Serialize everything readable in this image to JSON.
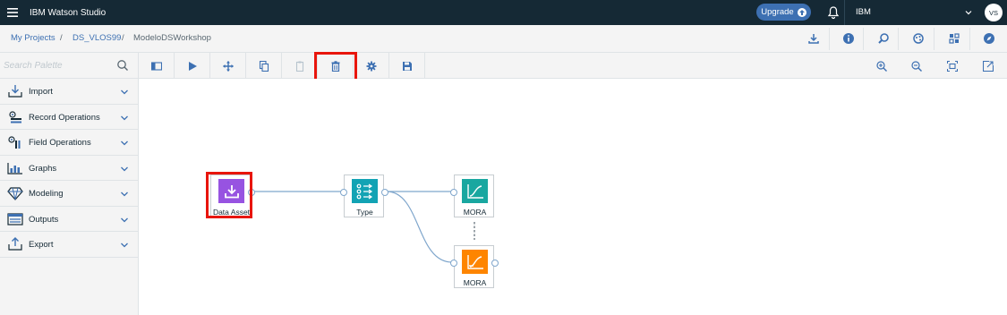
{
  "app": {
    "brand": "IBM Watson Studio"
  },
  "topbar": {
    "upgrade_label": "Upgrade",
    "account": "IBM",
    "avatar_initials": "VS"
  },
  "breadcrumb": {
    "items": [
      "My Projects",
      "DS_VLOS99",
      "ModeloDSWorkshop"
    ],
    "separator": "/"
  },
  "palette": {
    "search_placeholder": "Search Palette",
    "categories": [
      {
        "label": "Import",
        "icon": "import-icon"
      },
      {
        "label": "Record Operations",
        "icon": "record-ops-icon"
      },
      {
        "label": "Field Operations",
        "icon": "field-ops-icon"
      },
      {
        "label": "Graphs",
        "icon": "graphs-icon"
      },
      {
        "label": "Modeling",
        "icon": "modeling-icon"
      },
      {
        "label": "Outputs",
        "icon": "outputs-icon"
      },
      {
        "label": "Export",
        "icon": "export-icon"
      }
    ]
  },
  "canvas": {
    "nodes": [
      {
        "label": "Data Asset",
        "icon": "data-asset-icon",
        "color": "#9753e1"
      },
      {
        "label": "Type",
        "icon": "type-icon",
        "color": "#12a3b4"
      },
      {
        "label": "MORA",
        "icon": "model-nugget-icon",
        "color": "#19a7a0"
      },
      {
        "label": "MORA",
        "icon": "model-icon",
        "color": "#fe8500"
      }
    ]
  },
  "colors": {
    "topbar": "#152935",
    "accent": "#3d70b2",
    "highlight": "#e8150c"
  }
}
